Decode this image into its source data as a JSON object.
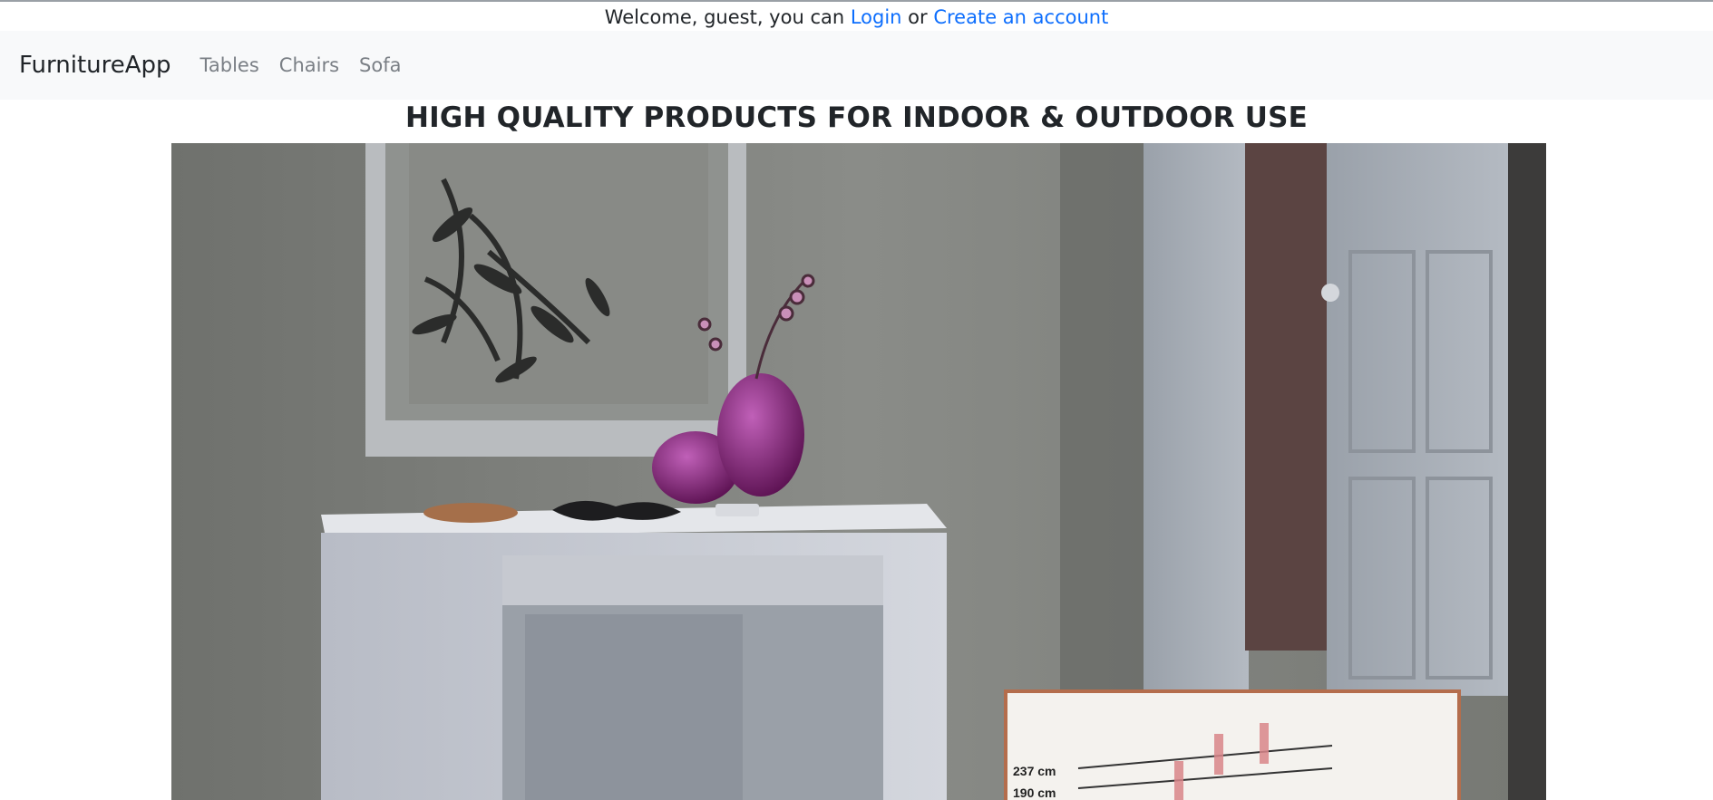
{
  "welcome": {
    "prefix": "Welcome, guest, you can ",
    "login_label": "Login",
    "separator": " or ",
    "create_label": "Create an account"
  },
  "navbar": {
    "brand": "FurnitureApp",
    "links": [
      {
        "label": "Tables"
      },
      {
        "label": "Chairs"
      },
      {
        "label": "Sofa"
      }
    ]
  },
  "hero": {
    "headline": "HIGH QUALITY PRODUCTS FOR INDOOR & OUTDOOR USE",
    "image_labels": {
      "measure_1": "237 cm",
      "measure_2": "190 cm"
    }
  },
  "colors": {
    "link": "#0d6efd",
    "navbar_bg": "#f8f9fa",
    "nav_link": "#7a7f85",
    "text": "#212529"
  }
}
